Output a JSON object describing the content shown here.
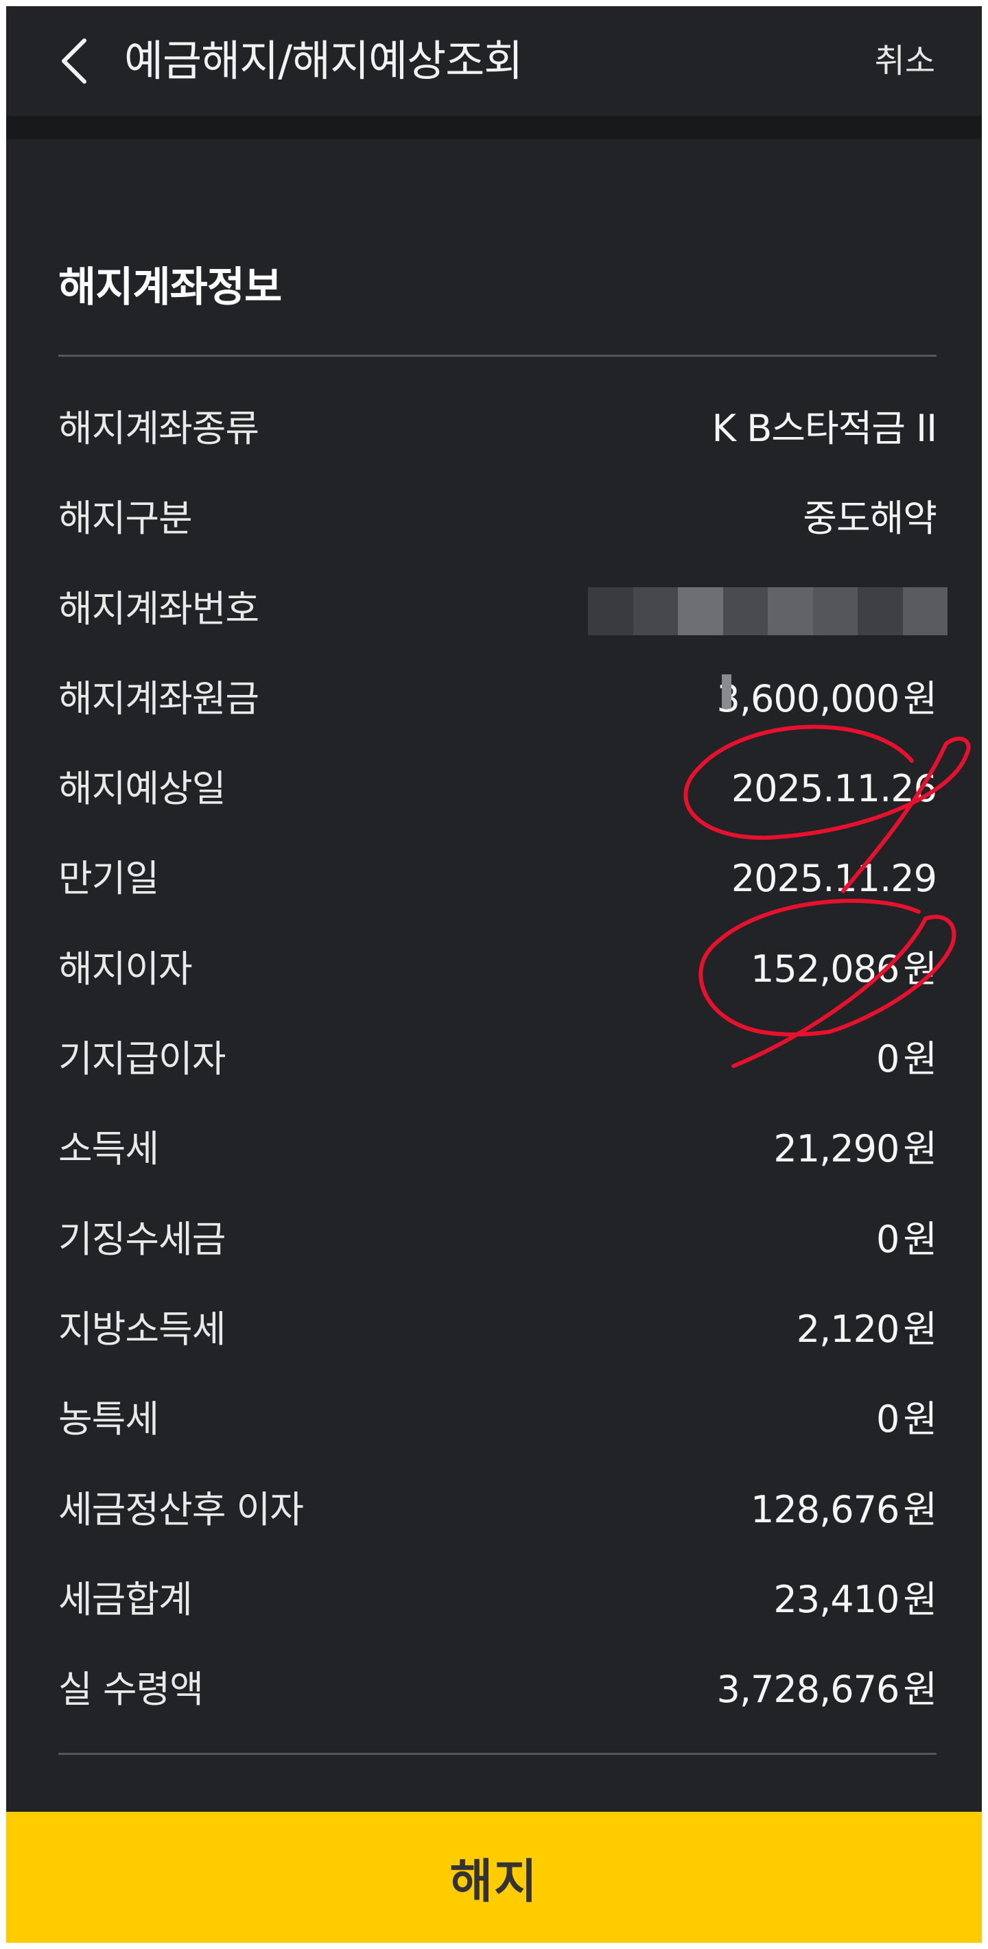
{
  "header": {
    "title": "예금해지/해지예상조회",
    "cancel_label": "취소"
  },
  "section": {
    "title": "해지계좌정보"
  },
  "rows": [
    {
      "label": "해지계좌종류",
      "value": "K B스타적금 II",
      "unit": ""
    },
    {
      "label": "해지구분",
      "value": "중도해약",
      "unit": ""
    },
    {
      "label": "해지계좌번호",
      "value": "",
      "unit": "",
      "masked": true
    },
    {
      "label": "해지계좌원금",
      "value": "3,600,000",
      "unit": "원"
    },
    {
      "label": "해지예상일",
      "value": "2025.11.26",
      "unit": ""
    },
    {
      "label": "만기일",
      "value": "2025.11.29",
      "unit": ""
    },
    {
      "label": "해지이자",
      "value": "152,086",
      "unit": "원"
    },
    {
      "label": "기지급이자",
      "value": "0",
      "unit": "원"
    },
    {
      "label": "소득세",
      "value": "21,290",
      "unit": "원"
    },
    {
      "label": "기징수세금",
      "value": "0",
      "unit": "원"
    },
    {
      "label": "지방소득세",
      "value": "2,120",
      "unit": "원"
    },
    {
      "label": "농특세",
      "value": "0",
      "unit": "원"
    },
    {
      "label": "세금정산후 이자",
      "value": "128,676",
      "unit": "원"
    },
    {
      "label": "세금합계",
      "value": "23,410",
      "unit": "원"
    },
    {
      "label": "실 수령액",
      "value": "3,728,676",
      "unit": "원"
    }
  ],
  "footer": {
    "action_label": "해지"
  },
  "colors": {
    "background": "#222326",
    "accent": "#ffcc00",
    "annotation": "#e8112d"
  },
  "icons": {
    "back": "chevron-left-icon"
  }
}
